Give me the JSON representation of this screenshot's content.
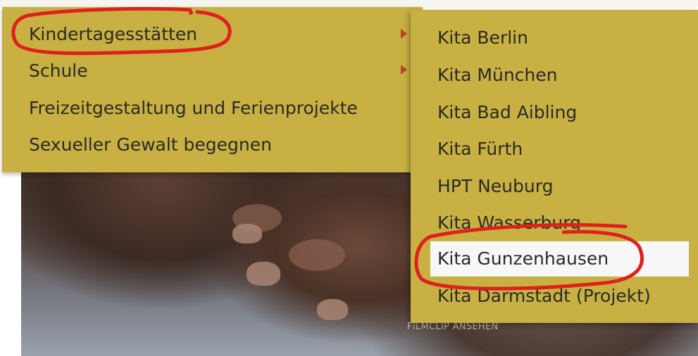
{
  "menu": {
    "items": [
      {
        "label": "Kindertagesstätten",
        "has_submenu": true
      },
      {
        "label": "Schule",
        "has_submenu": true
      },
      {
        "label": "Freizeitgestaltung und Ferienprojekte",
        "has_submenu": false
      },
      {
        "label": "Sexueller Gewalt begegnen",
        "has_submenu": false
      }
    ]
  },
  "submenu": {
    "parent": "Kindertagesstätten",
    "items": [
      {
        "label": "Kita Berlin"
      },
      {
        "label": "Kita München"
      },
      {
        "label": "Kita Bad Aibling"
      },
      {
        "label": "Kita Fürth"
      },
      {
        "label": "HPT Neuburg"
      },
      {
        "label": "Kita Wasserburg"
      },
      {
        "label": "Kita Gunzenhausen",
        "highlighted": true
      },
      {
        "label": "Kita Darmstadt (Projekt)"
      }
    ]
  },
  "background": {
    "caption": "FILMCLIP ANSEHEN"
  },
  "colors": {
    "menu_bg": "#c8b142",
    "menu_text": "#2a2a2a",
    "arrow": "#b8452b",
    "highlight_bg": "#f7f7f7",
    "annotation": "#e0201c"
  }
}
